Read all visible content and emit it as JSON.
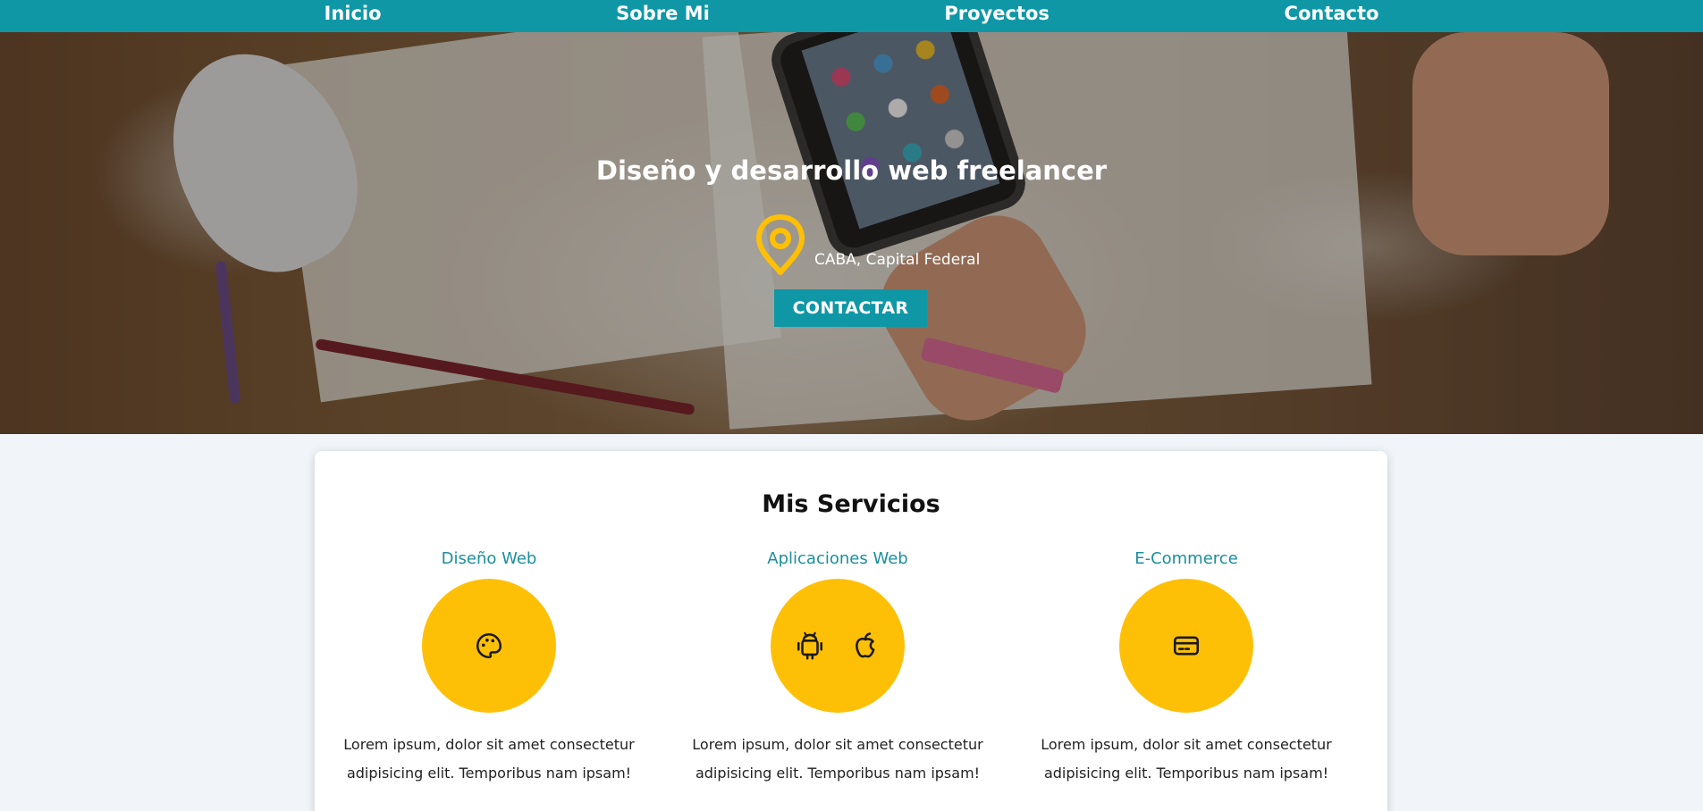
{
  "nav": {
    "items": [
      {
        "label": "Inicio"
      },
      {
        "label": "Sobre Mi"
      },
      {
        "label": "Proyectos"
      },
      {
        "label": "Contacto"
      }
    ]
  },
  "hero": {
    "title": "Diseño y desarrollo web freelancer",
    "location": "CABA, Capital Federal",
    "location_icon": "map-pin-icon",
    "cta_label": "CONTACTAR"
  },
  "services": {
    "title": "Mis Servicios",
    "items": [
      {
        "name": "Diseño Web",
        "icons": [
          "palette-icon"
        ],
        "description": "Lorem ipsum, dolor sit amet consectetur adipisicing elit. Temporibus nam ipsam!"
      },
      {
        "name": "Aplicaciones Web",
        "icons": [
          "android-icon",
          "apple-icon"
        ],
        "description": "Lorem ipsum, dolor sit amet consectetur adipisicing elit. Temporibus nam ipsam!"
      },
      {
        "name": "E-Commerce",
        "icons": [
          "credit-card-icon"
        ],
        "description": "Lorem ipsum, dolor sit amet consectetur adipisicing elit. Temporibus nam ipsam!"
      }
    ]
  },
  "colors": {
    "primary": "#0f97a6",
    "accent": "#fec007",
    "service_name": "#1a8f9c",
    "background": "#f1f5f9"
  }
}
